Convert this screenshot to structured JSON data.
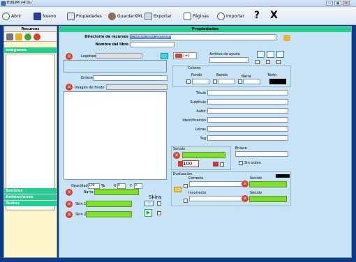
{
  "window": {
    "title": "EdiLIM  v4.0u",
    "minimize": "▭",
    "restore": "▣",
    "close": "✕"
  },
  "toolbar": {
    "open_label": "Abrir",
    "new_label": "Nuevo",
    "properties_label": "Propiedades",
    "save_xml_label": "GuardarXML",
    "export_label": "Exportar",
    "pages_label": "Páginas",
    "import_label": "Importar",
    "help_label": "?",
    "exit_label": "X"
  },
  "left_panel": {
    "header": "Recursos",
    "images_label": "Imágenes",
    "sounds_label": "Sonidos",
    "animations_label": "Animaciones",
    "texts_label": "Textos"
  },
  "main": {
    "header": "Propiedades",
    "resource_dir_label": "Directorio de recursos",
    "resource_dir_value": "C:\\edilim_ejem_portable\\",
    "book_name_label": "Nombre del libro",
    "book_name_value": "",
    "logo_label": "Logotipo",
    "link_label": "Enlace",
    "background_label": "Imagen de fondo",
    "opacity_label": "Opacidad",
    "opacity_value": "100",
    "percent": "%",
    "x_label": "X",
    "x_value": "0",
    "y_label": "Y",
    "y_value": "0",
    "bar_label": "Barra",
    "skins_label": "Skins",
    "skin1_label": "Skin 1",
    "skin2_label": "Skin 2",
    "help_file_label": "Archivo de ayuda",
    "help_button_label": "[+]",
    "colors_label": "Colores",
    "bg_color_label": "Fondo",
    "band_label": "Banda",
    "barra_label": "Barra",
    "text_color_label": "Texto",
    "title_label": "Título",
    "subtitle_label": "Subtítulo",
    "author_label": "Autor",
    "identification_label": "Identificación",
    "letters_label": "Letras",
    "tag_label": "Tag",
    "sound_label": "Sonido",
    "volume_value": "100",
    "link2_label": "Enlace",
    "no_order_label": "Sin orden",
    "evaluation_label": "Evaluación",
    "correct_label": "Correcto",
    "incorrect_label": "Incorrecto",
    "sound_correct_label": "Sonido",
    "sound_incorrect_label": "Sonido"
  },
  "colors": {
    "accent_green": "#23ce8f",
    "panel_blue": "#c9e3f6",
    "bar_green": "#7ee02a",
    "text_color": "#000000"
  }
}
